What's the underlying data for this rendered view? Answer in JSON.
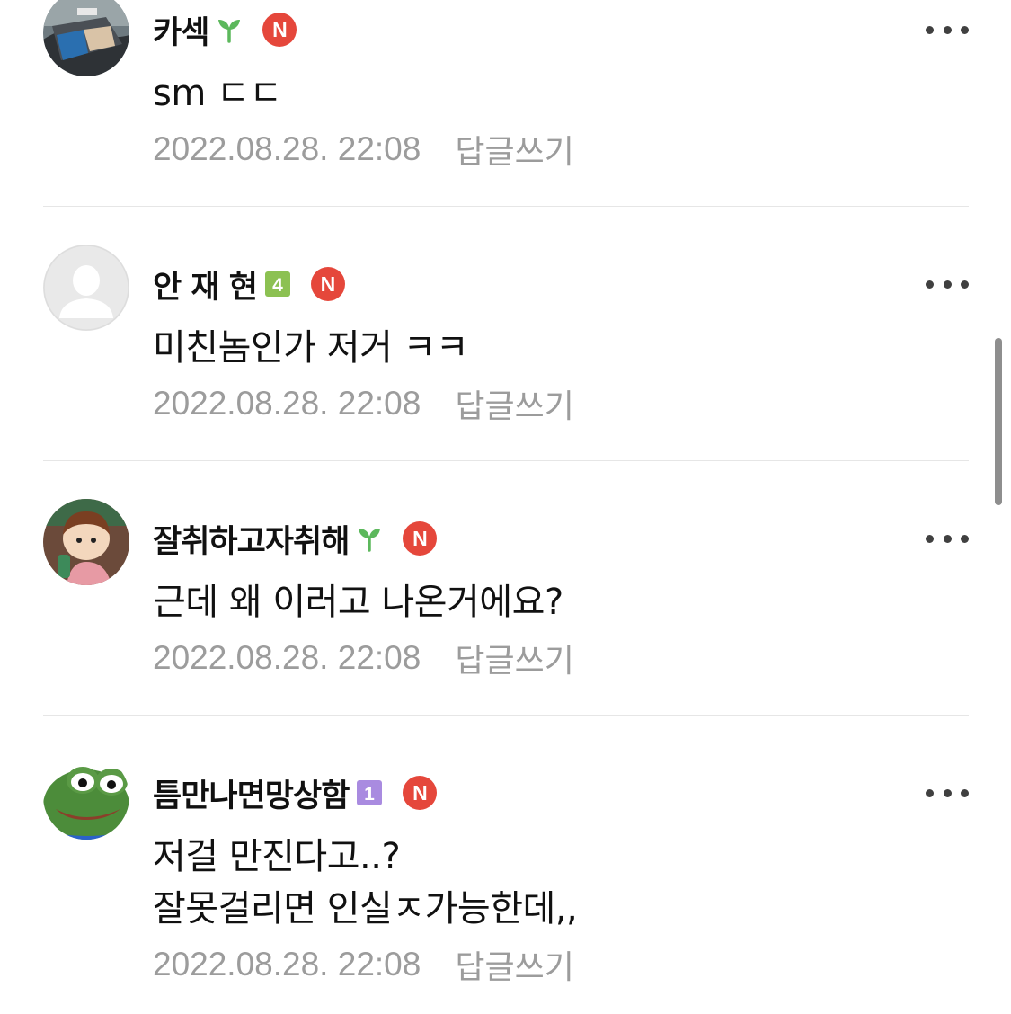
{
  "comments": [
    {
      "author": "카섹",
      "level_icon": "sprout-icon",
      "badge": "N",
      "text": "sm ㄷㄷ",
      "time": "2022.08.28. 22:08",
      "reply_label": "답글쓰기",
      "avatar": "car-photo-avatar"
    },
    {
      "author": "안 재 현",
      "level_icon": "level-4-icon",
      "level_value": "4",
      "badge": "N",
      "text": "미친놈인가 저거 ㅋㅋ",
      "time": "2022.08.28. 22:08",
      "reply_label": "답글쓰기",
      "avatar": "default-user-avatar"
    },
    {
      "author": "잘취하고자취해",
      "level_icon": "sprout-icon",
      "badge": "N",
      "text": "근데 왜 이러고 나온거에요?",
      "time": "2022.08.28. 22:08",
      "reply_label": "답글쓰기",
      "avatar": "anime-girl-avatar"
    },
    {
      "author": "틈만나면망상함",
      "level_icon": "level-1-icon",
      "level_value": "1",
      "badge": "N",
      "text_lines": [
        "저걸 만진다고..?",
        "잘못걸리면 인실ㅈ가능한데,,"
      ],
      "time": "2022.08.28. 22:08",
      "reply_label": "답글쓰기",
      "avatar": "frog-avatar"
    }
  ],
  "colors": {
    "badge": "#e5473b",
    "meta_text": "#9c9c9c",
    "sprout": "#5cb85c",
    "level4": "#8cc152",
    "level1": "#a98be0",
    "divider": "#e6e6e6"
  }
}
